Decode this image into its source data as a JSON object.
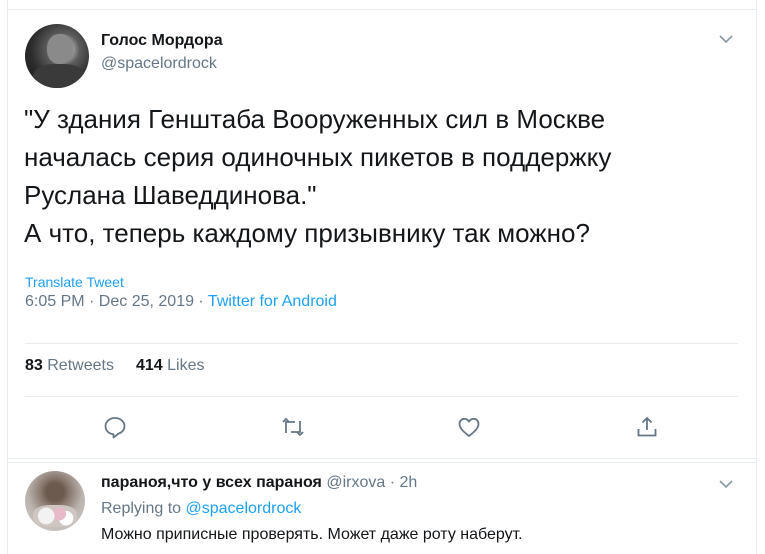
{
  "tweet": {
    "author_name": "Голос Мордора",
    "author_handle": "@spacelordrock",
    "text_lines": [
      "\"У здания Генштаба Вооруженных сил в Москве",
      "началась серия одиночных пикетов в поддержку",
      "Руслана Шаведдинова.\"",
      "А что, теперь каждому призывнику так можно?"
    ],
    "translate_label": "Translate Tweet",
    "timestamp": "6:05 PM · Dec 25, 2019 · ",
    "source_app": "Twitter for Android",
    "retweets_count": "83",
    "retweets_label": "Retweets",
    "likes_count": "414",
    "likes_label": "Likes"
  },
  "actions": {
    "reply_icon": "reply-icon",
    "retweet_icon": "retweet-icon",
    "like_icon": "heart-icon",
    "share_icon": "share-icon"
  },
  "reply": {
    "author_name": "параноя,что у всех параноя",
    "author_handle": "@irxova · 2h",
    "replying_prefix": "Replying to ",
    "replying_to": "@spacelordrock",
    "text": "Можно приписные проверять. Может даже роту наберут."
  },
  "colors": {
    "accent": "#1da1f2",
    "secondary_text": "#657786",
    "border": "#e6ecf0"
  }
}
